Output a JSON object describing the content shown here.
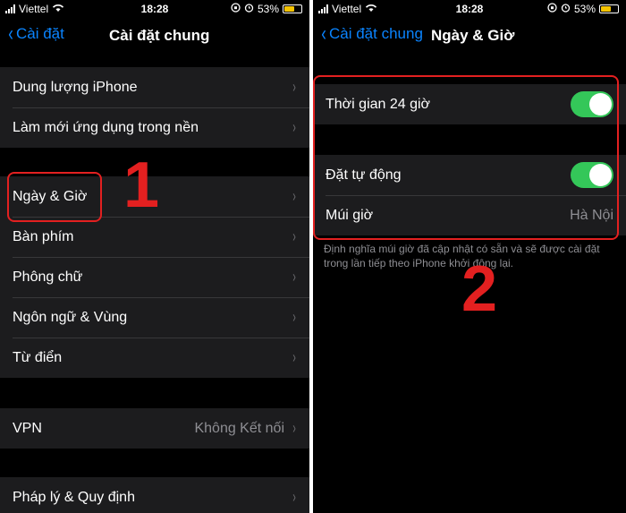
{
  "left": {
    "status": {
      "carrier": "Viettel",
      "time": "18:28",
      "battery": "53%"
    },
    "nav": {
      "back_label": "Cài đặt",
      "title": "Cài đặt chung"
    },
    "group1": [
      "Dung lượng iPhone",
      "Làm mới ứng dụng trong nền"
    ],
    "group2": [
      "Ngày & Giờ",
      "Bàn phím",
      "Phông chữ",
      "Ngôn ngữ & Vùng",
      "Từ điển"
    ],
    "vpn": {
      "label": "VPN",
      "value": "Không Kết nối"
    },
    "group4": [
      "Pháp lý & Quy định"
    ],
    "annotation": "1"
  },
  "right": {
    "status": {
      "carrier": "Viettel",
      "time": "18:28",
      "battery": "53%"
    },
    "nav": {
      "back_label": "Cài đặt chung",
      "title": "Ngày & Giờ"
    },
    "toggle_24h": {
      "label": "Thời gian 24 giờ",
      "on": true
    },
    "auto_set": {
      "label": "Đặt tự động",
      "on": true
    },
    "timezone": {
      "label": "Múi giờ",
      "value": "Hà Nội"
    },
    "note": "Định nghĩa múi giờ đã cập nhật có sẵn và sẽ được cài đặt trong lần tiếp theo iPhone khởi động lại.",
    "annotation": "2"
  },
  "colors": {
    "accent": "#0a84ff",
    "toggle_on": "#34c759",
    "annotation": "#e32020"
  }
}
